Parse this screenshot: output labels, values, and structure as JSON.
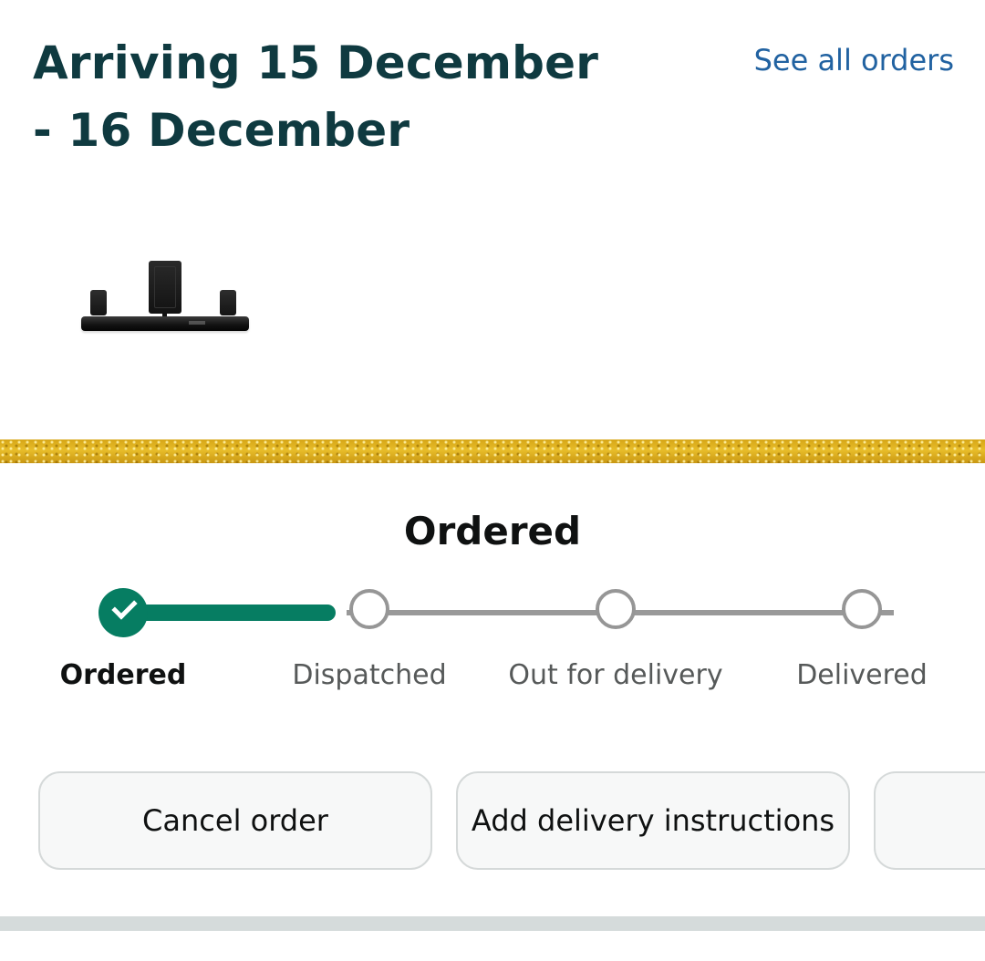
{
  "header": {
    "title": "Arriving 15 December - 16 December",
    "see_all_orders": "See all orders"
  },
  "product": {
    "image_icon": "soundbar-speaker-set-image"
  },
  "progress": {
    "title": "Ordered",
    "current_step_index": 0,
    "steps": [
      {
        "label": "Ordered",
        "state": "complete"
      },
      {
        "label": "Dispatched",
        "state": "pending"
      },
      {
        "label": "Out for delivery",
        "state": "pending"
      },
      {
        "label": "Delivered",
        "state": "pending"
      }
    ],
    "colors": {
      "complete": "#067d62",
      "pending": "#969696"
    }
  },
  "actions": {
    "cancel_order": "Cancel order",
    "add_delivery_instructions": "Add delivery instructions",
    "third_button_label": ""
  },
  "colors": {
    "title": "#0f3a40",
    "link": "#2162a1",
    "glitter_band": "#e0b020",
    "button_border": "#d5d9d9",
    "divider": "#d5dbdb"
  }
}
